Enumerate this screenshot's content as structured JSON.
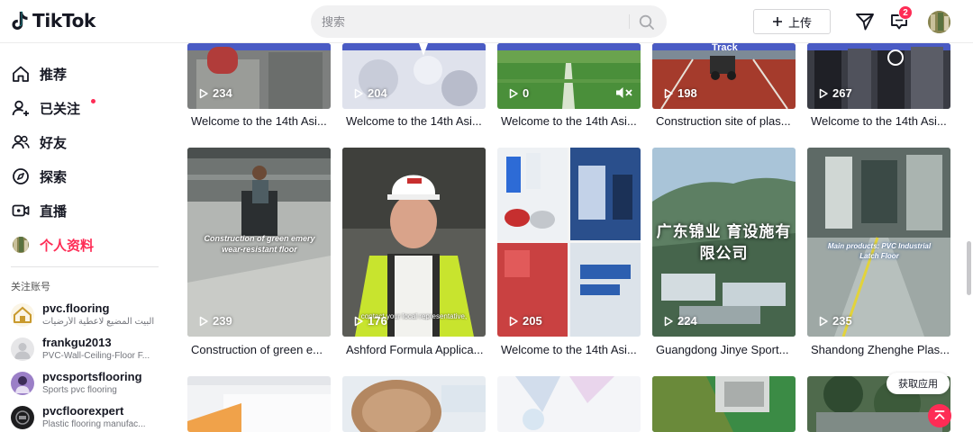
{
  "app": {
    "name": "TikTok"
  },
  "header": {
    "search_placeholder": "搜索",
    "upload_label": "上传",
    "notification_count": "2"
  },
  "sidebar": {
    "nav": [
      {
        "label": "推荐",
        "icon": "home-icon"
      },
      {
        "label": "已关注",
        "icon": "following-icon"
      },
      {
        "label": "好友",
        "icon": "friends-icon"
      },
      {
        "label": "探索",
        "icon": "compass-icon"
      },
      {
        "label": "直播",
        "icon": "live-icon"
      },
      {
        "label": "个人资料",
        "icon": "profile-avatar-icon",
        "active": true
      }
    ],
    "following_title": "关注账号",
    "following": [
      {
        "name": "pvc.flooring",
        "desc": "البيت المضيع لاعطية الأرضيات"
      },
      {
        "name": "frankgu2013",
        "desc": "PVC-Wall-Ceiling-Floor F..."
      },
      {
        "name": "pvcsportsflooring",
        "desc": "Sports pvc flooring"
      },
      {
        "name": "pvcfloorexpert",
        "desc": "Plastic flooring manufac..."
      }
    ]
  },
  "videos": {
    "row1": [
      {
        "views": "234",
        "title": "Welcome to the 14th Asi..."
      },
      {
        "views": "204",
        "title": "Welcome to the 14th Asi..."
      },
      {
        "views": "0",
        "title": "Welcome to the 14th Asi..."
      },
      {
        "views": "198",
        "title": "Construction site of plas...",
        "overlay_text": "Track"
      },
      {
        "views": "267",
        "title": "Welcome to the 14th Asi..."
      }
    ],
    "row2": [
      {
        "views": "239",
        "title": "Construction of green e...",
        "overlay_text": "Construction of green emery wear-resistant floor"
      },
      {
        "views": "176",
        "title": "Ashford Formula Applica...",
        "overlay_text": "contact your local representative,"
      },
      {
        "views": "205",
        "title": "Welcome to the 14th Asi..."
      },
      {
        "views": "224",
        "title": "Guangdong Jinye Sport...",
        "overlay_text": "广东锦业 育设施有限公司"
      },
      {
        "views": "235",
        "title": "Shandong Zhenghe Plas...",
        "overlay_text": "Main products: PVC Industrial Latch Floor"
      }
    ]
  },
  "floating": {
    "get_app_label": "获取应用"
  },
  "colors": {
    "accent": "#fe2c55",
    "text": "#161823"
  }
}
